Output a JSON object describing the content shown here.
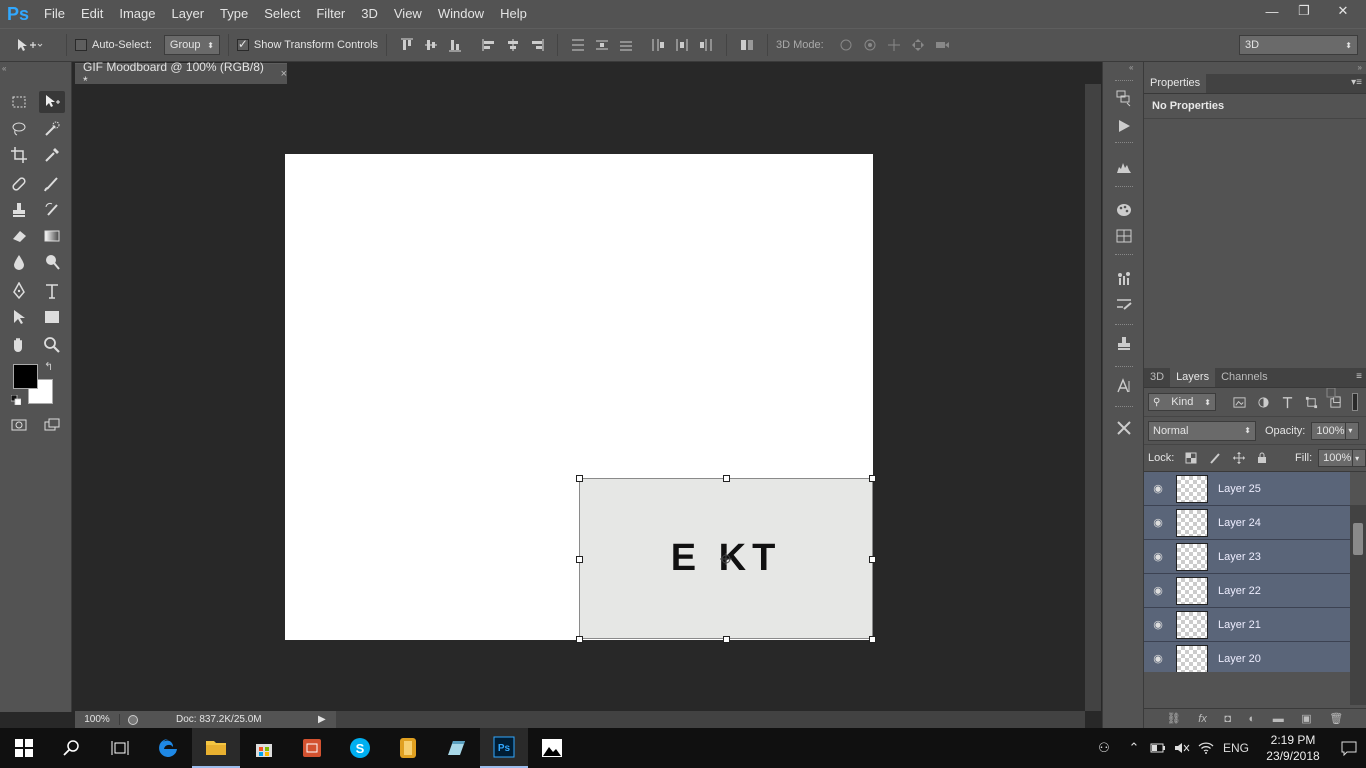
{
  "app": {
    "logo": "Ps"
  },
  "menu": [
    "File",
    "Edit",
    "Image",
    "Layer",
    "Type",
    "Select",
    "Filter",
    "3D",
    "View",
    "Window",
    "Help"
  ],
  "window_controls": {
    "minimize": "—",
    "restore": "❐",
    "close": "✕"
  },
  "options_bar": {
    "auto_select_label": "Auto-Select:",
    "auto_select_checked": false,
    "group_value": "Group",
    "show_transform_label": "Show Transform Controls",
    "show_transform_checked": true,
    "mode_3d_label": "3D Mode:",
    "workspace_value": "3D"
  },
  "document": {
    "tab_title": "GIF Moodboard @ 100% (RGB/8) *",
    "tab_close": "×",
    "layer_text": "E  KT"
  },
  "status": {
    "zoom": "100%",
    "doc_info": "Doc: 837.2K/25.0M",
    "arrow": "▶"
  },
  "properties": {
    "tab": "Properties",
    "body": "No Properties"
  },
  "layers_panel": {
    "tabs": [
      "3D",
      "Layers",
      "Channels"
    ],
    "active_tab": "Layers",
    "filter_kind": "Kind",
    "blend_mode": "Normal",
    "opacity_label": "Opacity:",
    "opacity_value": "100%",
    "lock_label": "Lock:",
    "fill_label": "Fill:",
    "fill_value": "100%",
    "layers": [
      "Layer 25",
      "Layer 24",
      "Layer 23",
      "Layer 22",
      "Layer 21",
      "Layer 20"
    ]
  },
  "taskbar": {
    "language": "ENG",
    "time": "2:19 PM",
    "date": "23/9/2018"
  },
  "colors": {
    "foreground": "#000000",
    "background": "#ffffff",
    "panel": "#535353",
    "pasteboard": "#282828",
    "layer_selected": "#5a6579"
  }
}
